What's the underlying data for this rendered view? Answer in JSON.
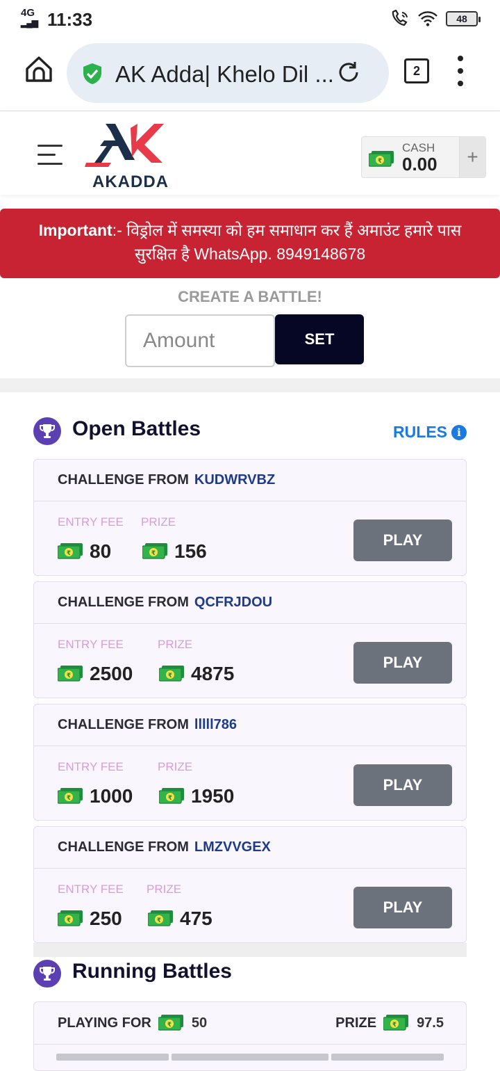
{
  "status_bar": {
    "network": "4G",
    "time": "11:33",
    "battery": "48"
  },
  "browser": {
    "url_text": "AK Adda| Khelo Dil ...",
    "tab_count": "2"
  },
  "header": {
    "logo_text": "AKADDA",
    "wallet_label": "CASH",
    "wallet_value": "0.00",
    "wallet_add": "+"
  },
  "alert": {
    "prefix": "Important",
    "message": ":- विड्रोल में समस्या को हम समाधान कर हैं अमाउंट हमारे पास सुरक्षित है WhatsApp. 8949148678"
  },
  "create_battle": {
    "title": "CREATE A BATTLE!",
    "amount_placeholder": "Amount",
    "set_label": "SET"
  },
  "open_battles": {
    "title": "Open Battles",
    "rules_label": "RULES",
    "challenge_prefix": "CHALLENGE FROM",
    "entry_fee_label": "ENTRY FEE",
    "prize_label": "PRIZE",
    "play_label": "PLAY",
    "battles": [
      {
        "user": "KUDWRVBZ",
        "entry_fee": "80",
        "prize": "156"
      },
      {
        "user": "QCFRJDOU",
        "entry_fee": "2500",
        "prize": "4875"
      },
      {
        "user": "lllll786",
        "entry_fee": "1000",
        "prize": "1950"
      },
      {
        "user": "LMZVVGEX",
        "entry_fee": "250",
        "prize": "475"
      }
    ]
  },
  "running_battles": {
    "title": "Running Battles",
    "playing_for_label": "PLAYING FOR",
    "playing_for_value": "50",
    "prize_label": "PRIZE",
    "prize_value": "97.5"
  },
  "colors": {
    "alert_bg": "#c82333",
    "set_button": "#060625",
    "play_button": "#6c727b",
    "accent_blue": "#1a7ae0",
    "trophy_bg": "#5b3fb3"
  }
}
